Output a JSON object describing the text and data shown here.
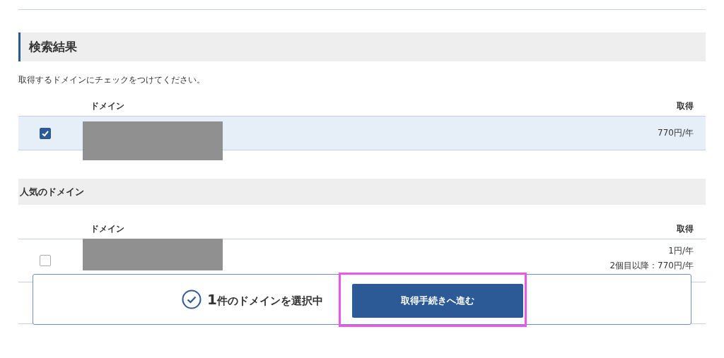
{
  "search_results": {
    "title": "検索結果",
    "instruction": "取得するドメインにチェックをつけてください。",
    "columns": [
      "ドメイン",
      "取得"
    ],
    "rows": [
      {
        "checked": true,
        "price_lines": [
          "770円/年"
        ]
      }
    ]
  },
  "popular": {
    "title": "人気のドメイン",
    "columns": [
      "ドメイン",
      "取得"
    ],
    "rows": [
      {
        "checked": false,
        "price_lines": [
          "1円/年",
          "2個目以降：770円/年"
        ]
      }
    ]
  },
  "selection_bar": {
    "count": "1",
    "count_suffix": "件のドメインを選択中",
    "button": "取得手続きへ進む",
    "highlighted": true
  }
}
